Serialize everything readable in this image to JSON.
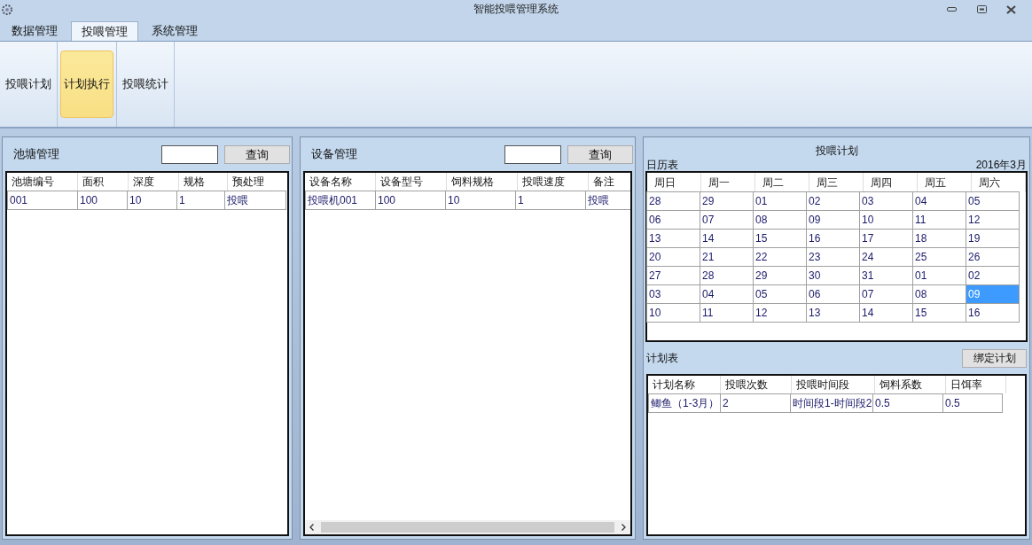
{
  "window": {
    "title": "智能投喂管理系统"
  },
  "tabs": [
    {
      "label": "数据管理",
      "selected": false
    },
    {
      "label": "投喂管理",
      "selected": true
    },
    {
      "label": "系统管理",
      "selected": false
    }
  ],
  "ribbon": [
    {
      "label": "投喂计划",
      "selected": false
    },
    {
      "label": "计划执行",
      "selected": true
    },
    {
      "label": "投喂统计",
      "selected": false
    }
  ],
  "pond_panel": {
    "title": "池塘管理",
    "button": "查询",
    "columns": [
      "池塘编号",
      "面积",
      "深度",
      "规格",
      "预处理"
    ],
    "rows": [
      [
        "001",
        "100",
        "10",
        "1",
        "投喂"
      ]
    ]
  },
  "device_panel": {
    "title": "设备管理",
    "button": "查询",
    "columns": [
      "设备名称",
      "设备型号",
      "饲料规格",
      "投喂速度",
      "备注"
    ],
    "rows": [
      [
        "投喂机001",
        "100",
        "10",
        "1",
        "投喂"
      ]
    ]
  },
  "plan_panel": {
    "title": "投喂计划",
    "calendar_label": "日历表",
    "month": "2016年3月",
    "weekdays": [
      "周日",
      "周一",
      "周二",
      "周三",
      "周四",
      "周五",
      "周六"
    ],
    "weeks": [
      [
        {
          "day": "28",
          "selected": false
        },
        {
          "day": "29",
          "selected": false
        },
        {
          "day": "01",
          "selected": false
        },
        {
          "day": "02",
          "selected": false
        },
        {
          "day": "03",
          "selected": false
        },
        {
          "day": "04",
          "selected": false
        },
        {
          "day": "05",
          "selected": false
        }
      ],
      [
        {
          "day": "06",
          "selected": false
        },
        {
          "day": "07",
          "selected": false
        },
        {
          "day": "08",
          "selected": false
        },
        {
          "day": "09",
          "selected": false
        },
        {
          "day": "10",
          "selected": false
        },
        {
          "day": "11",
          "selected": false
        },
        {
          "day": "12",
          "selected": false
        }
      ],
      [
        {
          "day": "13",
          "selected": false
        },
        {
          "day": "14",
          "selected": false
        },
        {
          "day": "15",
          "selected": false
        },
        {
          "day": "16",
          "selected": false
        },
        {
          "day": "17",
          "selected": false
        },
        {
          "day": "18",
          "selected": false
        },
        {
          "day": "19",
          "selected": false
        }
      ],
      [
        {
          "day": "20",
          "selected": false
        },
        {
          "day": "21",
          "selected": false
        },
        {
          "day": "22",
          "selected": false
        },
        {
          "day": "23",
          "selected": false
        },
        {
          "day": "24",
          "selected": false
        },
        {
          "day": "25",
          "selected": false
        },
        {
          "day": "26",
          "selected": false
        }
      ],
      [
        {
          "day": "27",
          "selected": false
        },
        {
          "day": "28",
          "selected": false
        },
        {
          "day": "29",
          "selected": false
        },
        {
          "day": "30",
          "selected": false
        },
        {
          "day": "31",
          "selected": false
        },
        {
          "day": "01",
          "selected": false
        },
        {
          "day": "02",
          "selected": false
        }
      ],
      [
        {
          "day": "03",
          "selected": false
        },
        {
          "day": "04",
          "selected": false
        },
        {
          "day": "05",
          "selected": false
        },
        {
          "day": "06",
          "selected": false
        },
        {
          "day": "07",
          "selected": false
        },
        {
          "day": "08",
          "selected": false
        },
        {
          "day": "09",
          "selected": true
        }
      ],
      [
        {
          "day": "10",
          "selected": false
        },
        {
          "day": "11",
          "selected": false
        },
        {
          "day": "12",
          "selected": false
        },
        {
          "day": "13",
          "selected": false
        },
        {
          "day": "14",
          "selected": false
        },
        {
          "day": "15",
          "selected": false
        },
        {
          "day": "16",
          "selected": false
        }
      ]
    ]
  },
  "schedule": {
    "title": "计划表",
    "button": "绑定计划",
    "columns": [
      "计划名称",
      "投喂次数",
      "投喂时间段",
      "饲料系数",
      "日饵率"
    ],
    "rows": [
      [
        "鲫鱼（1-3月）",
        "2",
        "时间段1-时间段2",
        "0.5",
        "0.5"
      ]
    ]
  }
}
